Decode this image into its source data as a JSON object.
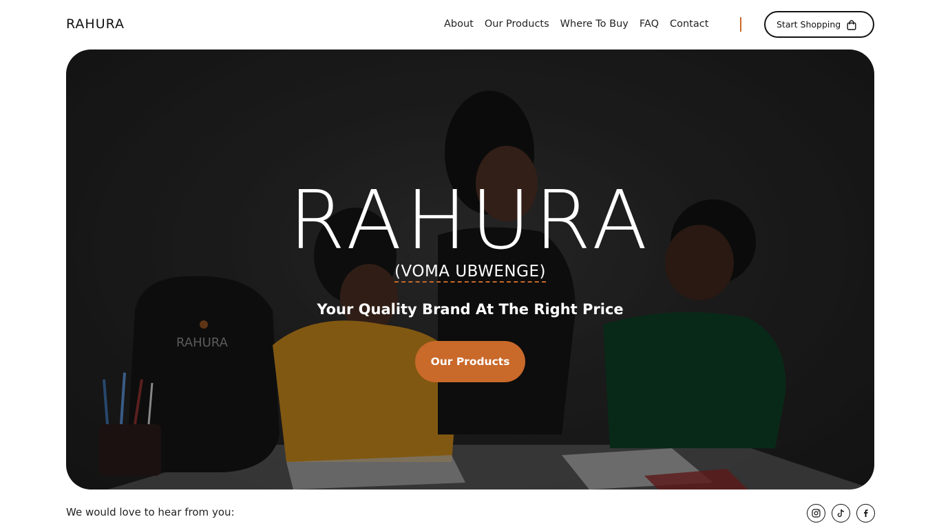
{
  "header": {
    "logo_text": "RAHURA",
    "nav": [
      {
        "label": "About"
      },
      {
        "label": "Our Products"
      },
      {
        "label": "Where To Buy"
      },
      {
        "label": "FAQ"
      },
      {
        "label": "Contact"
      }
    ],
    "shop_button_label": "Start Shopping",
    "shop_button_icon": "shopping-bag-icon"
  },
  "hero": {
    "title": "RAHURA",
    "subtitle": "(VOMA UBWENGE)",
    "tagline": "Your Quality Brand At The Right Price",
    "cta_label": "Our Products",
    "backpack_logo": "RAHURA"
  },
  "footer": {
    "contact_text": "We would love to hear from you:",
    "socials": [
      "instagram-icon",
      "tiktok-icon",
      "facebook-icon"
    ]
  },
  "colors": {
    "accent": "#c9692a",
    "text": "#1a1a1a",
    "hero_bg": "#2a2a2a"
  }
}
